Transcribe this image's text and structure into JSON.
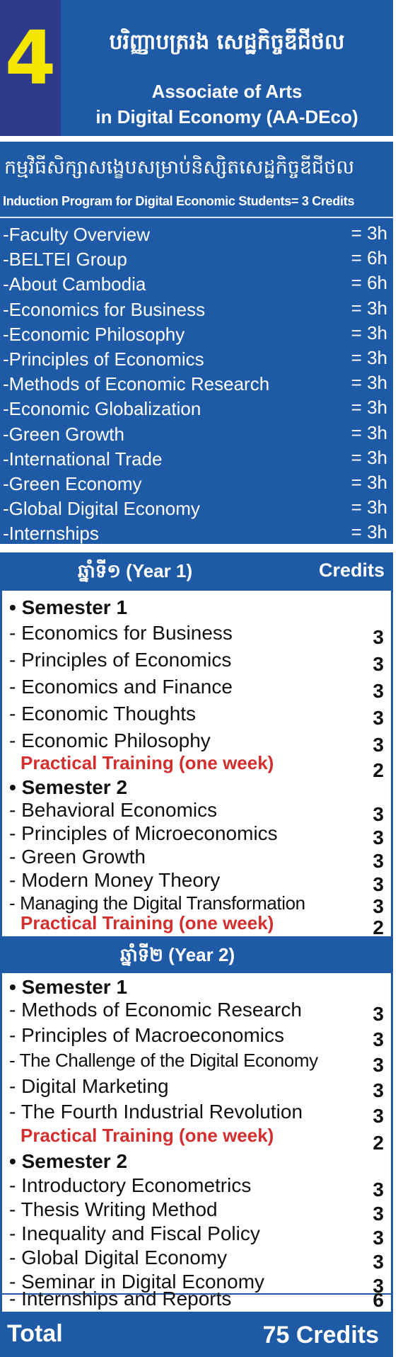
{
  "header": {
    "number": "4",
    "title_km": "បរិញ្ញាបត្ររង សេដ្ឋកិច្ចឌីជីថល",
    "title_en_line1": "Associate of Arts",
    "title_en_line2": "in Digital Economy (AA-DEco)"
  },
  "induction": {
    "title_km": "កម្មវិធីសិក្សាសង្ខេបសម្រាប់និស្សិតសេដ្ឋកិច្ចឌីជីថល",
    "title_en": "Induction Program for Digital Economic Students= 3 Credits",
    "items": [
      {
        "name": "-Faculty Overview",
        "hours": "= 3h"
      },
      {
        "name": "-BELTEI Group",
        "hours": "= 6h"
      },
      {
        "name": "-About Cambodia",
        "hours": "= 6h"
      },
      {
        "name": "-Economics for Business",
        "hours": "= 3h"
      },
      {
        "name": "-Economic Philosophy",
        "hours": "= 3h"
      },
      {
        "name": "-Principles of Economics",
        "hours": "= 3h"
      },
      {
        "name": "-Methods of Economic Research",
        "hours": "= 3h"
      },
      {
        "name": "-Economic Globalization",
        "hours": "= 3h"
      },
      {
        "name": "-Green Growth",
        "hours": "= 3h"
      },
      {
        "name": "-International Trade",
        "hours": "= 3h"
      },
      {
        "name": "-Green Economy",
        "hours": "= 3h"
      },
      {
        "name": "-Global Digital Economy",
        "hours": "= 3h"
      },
      {
        "name": "-Internships",
        "hours": "= 3h"
      }
    ]
  },
  "year1": {
    "title": "ឆ្នាំទី១ (Year 1)",
    "credits_header": "Credits",
    "semester1": {
      "label": "• Semester 1",
      "courses": [
        {
          "name": "- Economics for Business",
          "credits": "3"
        },
        {
          "name": "- Principles of Economics",
          "credits": "3"
        },
        {
          "name": "- Economics and Finance",
          "credits": "3"
        },
        {
          "name": "- Economic Thoughts",
          "credits": "3"
        },
        {
          "name": "- Economic Philosophy",
          "credits": "3"
        }
      ],
      "practical": {
        "name": "Practical Training (one week)",
        "credits": "2"
      }
    },
    "semester2": {
      "label": "• Semester 2",
      "courses": [
        {
          "name": "- Behavioral Economics",
          "credits": "3"
        },
        {
          "name": "- Principles of Microeconomics",
          "credits": "3"
        },
        {
          "name": "- Green Growth",
          "credits": "3"
        },
        {
          "name": "- Modern Money Theory",
          "credits": "3"
        },
        {
          "name": "- Managing the Digital Transformation",
          "credits": "3"
        }
      ],
      "practical": {
        "name": "Practical Training (one week)",
        "credits": "2"
      }
    }
  },
  "year2": {
    "title": "ឆ្នាំទី២ (Year 2)",
    "semester1": {
      "label": "• Semester 1",
      "courses": [
        {
          "name": "- Methods of Economic Research",
          "credits": "3"
        },
        {
          "name": "- Principles of Macroeconomics",
          "credits": "3"
        },
        {
          "name": "- The Challenge of the Digital Economy",
          "credits": "3"
        },
        {
          "name": "- Digital Marketing",
          "credits": "3"
        },
        {
          "name": "- The Fourth Industrial Revolution",
          "credits": "3"
        }
      ],
      "practical": {
        "name": "Practical Training (one week)",
        "credits": "2"
      }
    },
    "semester2": {
      "label": "• Semester 2",
      "courses": [
        {
          "name": "- Introductory Econometrics",
          "credits": "3"
        },
        {
          "name": "- Thesis Writing Method",
          "credits": "3"
        },
        {
          "name": "- Inequality and Fiscal Policy",
          "credits": "3"
        },
        {
          "name": "- Global Digital Economy",
          "credits": "3"
        },
        {
          "name": "- Seminar in Digital Economy",
          "credits": "3"
        }
      ]
    },
    "internship": {
      "name": "- Internships and Reports",
      "credits": "6"
    }
  },
  "total": {
    "label": "Total",
    "value": "75 Credits"
  },
  "colors": {
    "primary_blue": "#1f5aa6",
    "number_box": "#2f3a8c",
    "number_yellow": "#f5e600",
    "practical_red": "#d32f2f"
  }
}
